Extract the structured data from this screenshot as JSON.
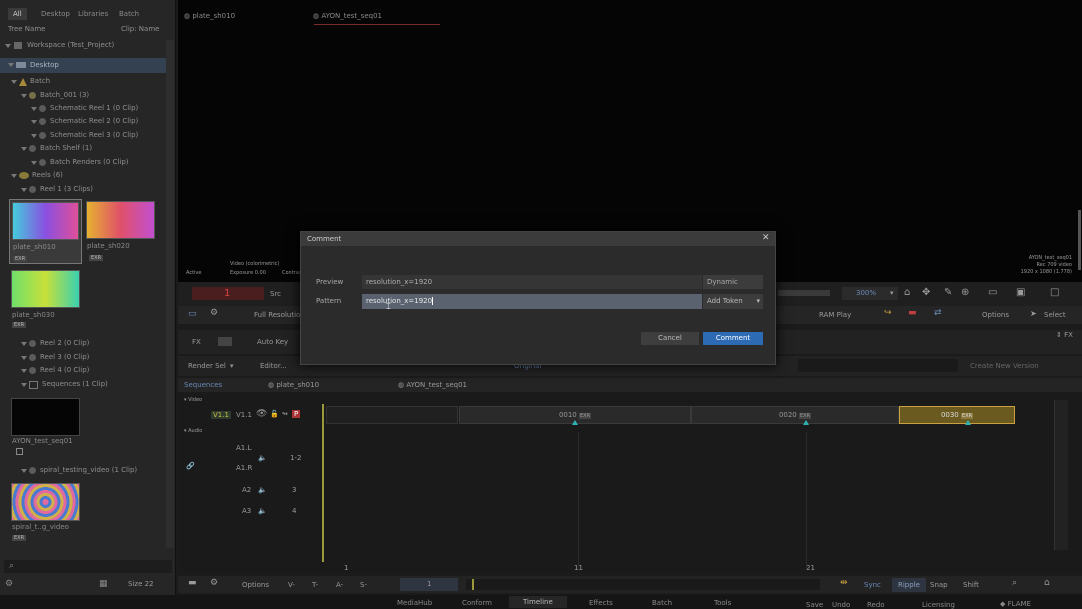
{
  "left_panel": {
    "tabs": [
      "All",
      "Desktop",
      "Libraries",
      "Batch"
    ],
    "tree_label": "Tree Name",
    "clip_label": "Clip: Name",
    "workspace": "Workspace (Test_Project)",
    "desktop": "Desktop",
    "batch": "Batch",
    "batch_001": "Batch_001 (3)",
    "schematic1": "Schematic Reel 1 (0 Clip)",
    "schematic2": "Schematic Reel 2 (0 Clip)",
    "schematic3": "Schematic Reel 3 (0 Clip)",
    "batch_shelf": "Batch Shelf (1)",
    "batch_renders": "Batch Renders (0 Clip)",
    "reels": "Reels (6)",
    "reel1": "Reel 1 (3 Clips)",
    "clips": [
      {
        "label": "plate_sh010",
        "badge": "EXR"
      },
      {
        "label": "plate_sh020",
        "badge": "EXR"
      },
      {
        "label": "plate_sh030",
        "badge": "EXR"
      }
    ],
    "reel2": "Reel 2 (0 Clip)",
    "reel3": "Reel 3 (0 Clip)",
    "reel4": "Reel 4 (0 Clip)",
    "sequences": "Sequences (1 Clip)",
    "seq_clip": "AYON_test_seq01",
    "spiral": "spiral_testing_video (1 Clip)",
    "spiral_clip": {
      "label": "spiral_t..g_video",
      "badge": "EXR"
    },
    "size_label": "Size 22"
  },
  "viewer": {
    "tabs": [
      "plate_sh010",
      "AYON_test_seq01"
    ],
    "info_lines": [
      "AYON_test_seq01",
      "Rec 709 video",
      "1920 x 1080 (1.778)"
    ],
    "overlay_left": [
      "Active",
      "Video (colorimetric)",
      "Exposure 0.00",
      "Contrast"
    ]
  },
  "controls": {
    "frame": "1",
    "src": "Src",
    "full_res": "Full Resolution",
    "zoom": "300%",
    "ram_play": "RAM Play",
    "options": "Options",
    "select": "Select",
    "fx": "FX",
    "auto_key": "Auto Key",
    "render_sel": "Render Sel",
    "editor": "Editor...",
    "original": "Original",
    "create_new_version": "Create New Version"
  },
  "dialog": {
    "title": "Comment",
    "preview_label": "Preview",
    "preview_value": "resolution_x=1920",
    "preview_mode": "Dynamic",
    "pattern_label": "Pattern",
    "pattern_value": "resolution_x=1920",
    "add_token": "Add Token",
    "cancel": "Cancel",
    "comment": "Comment"
  },
  "timeline": {
    "tabs": [
      "Sequences",
      "plate_sh010",
      "AYON_test_seq01"
    ],
    "video_label": "Video",
    "audio_label": "Audio",
    "v1": "V1.1",
    "v1b": "V1.1",
    "p_badge": "P",
    "a1l": "A1.L",
    "a1r": "A1.R",
    "a2": "A2",
    "a3": "A3",
    "a_ch": [
      "1-2",
      "3",
      "4"
    ],
    "segments": [
      {
        "label": "0010",
        "badge": "EXR"
      },
      {
        "label": "0020",
        "badge": "EXR"
      },
      {
        "label": "0030",
        "badge": "EXR"
      }
    ],
    "ruler": [
      "1",
      "11",
      "21"
    ],
    "bottom_options": "Options",
    "frame_field": "1",
    "sync": "Sync",
    "ripple": "Ripple",
    "snap": "Snap",
    "shift": "Shift"
  },
  "bottom_tabs": [
    "MediaHub",
    "Conform",
    "Timeline",
    "Effects",
    "Batch",
    "Tools"
  ],
  "bottom_right": [
    "Save",
    "Undo",
    "Redo",
    "Licensing",
    "FLAME"
  ]
}
